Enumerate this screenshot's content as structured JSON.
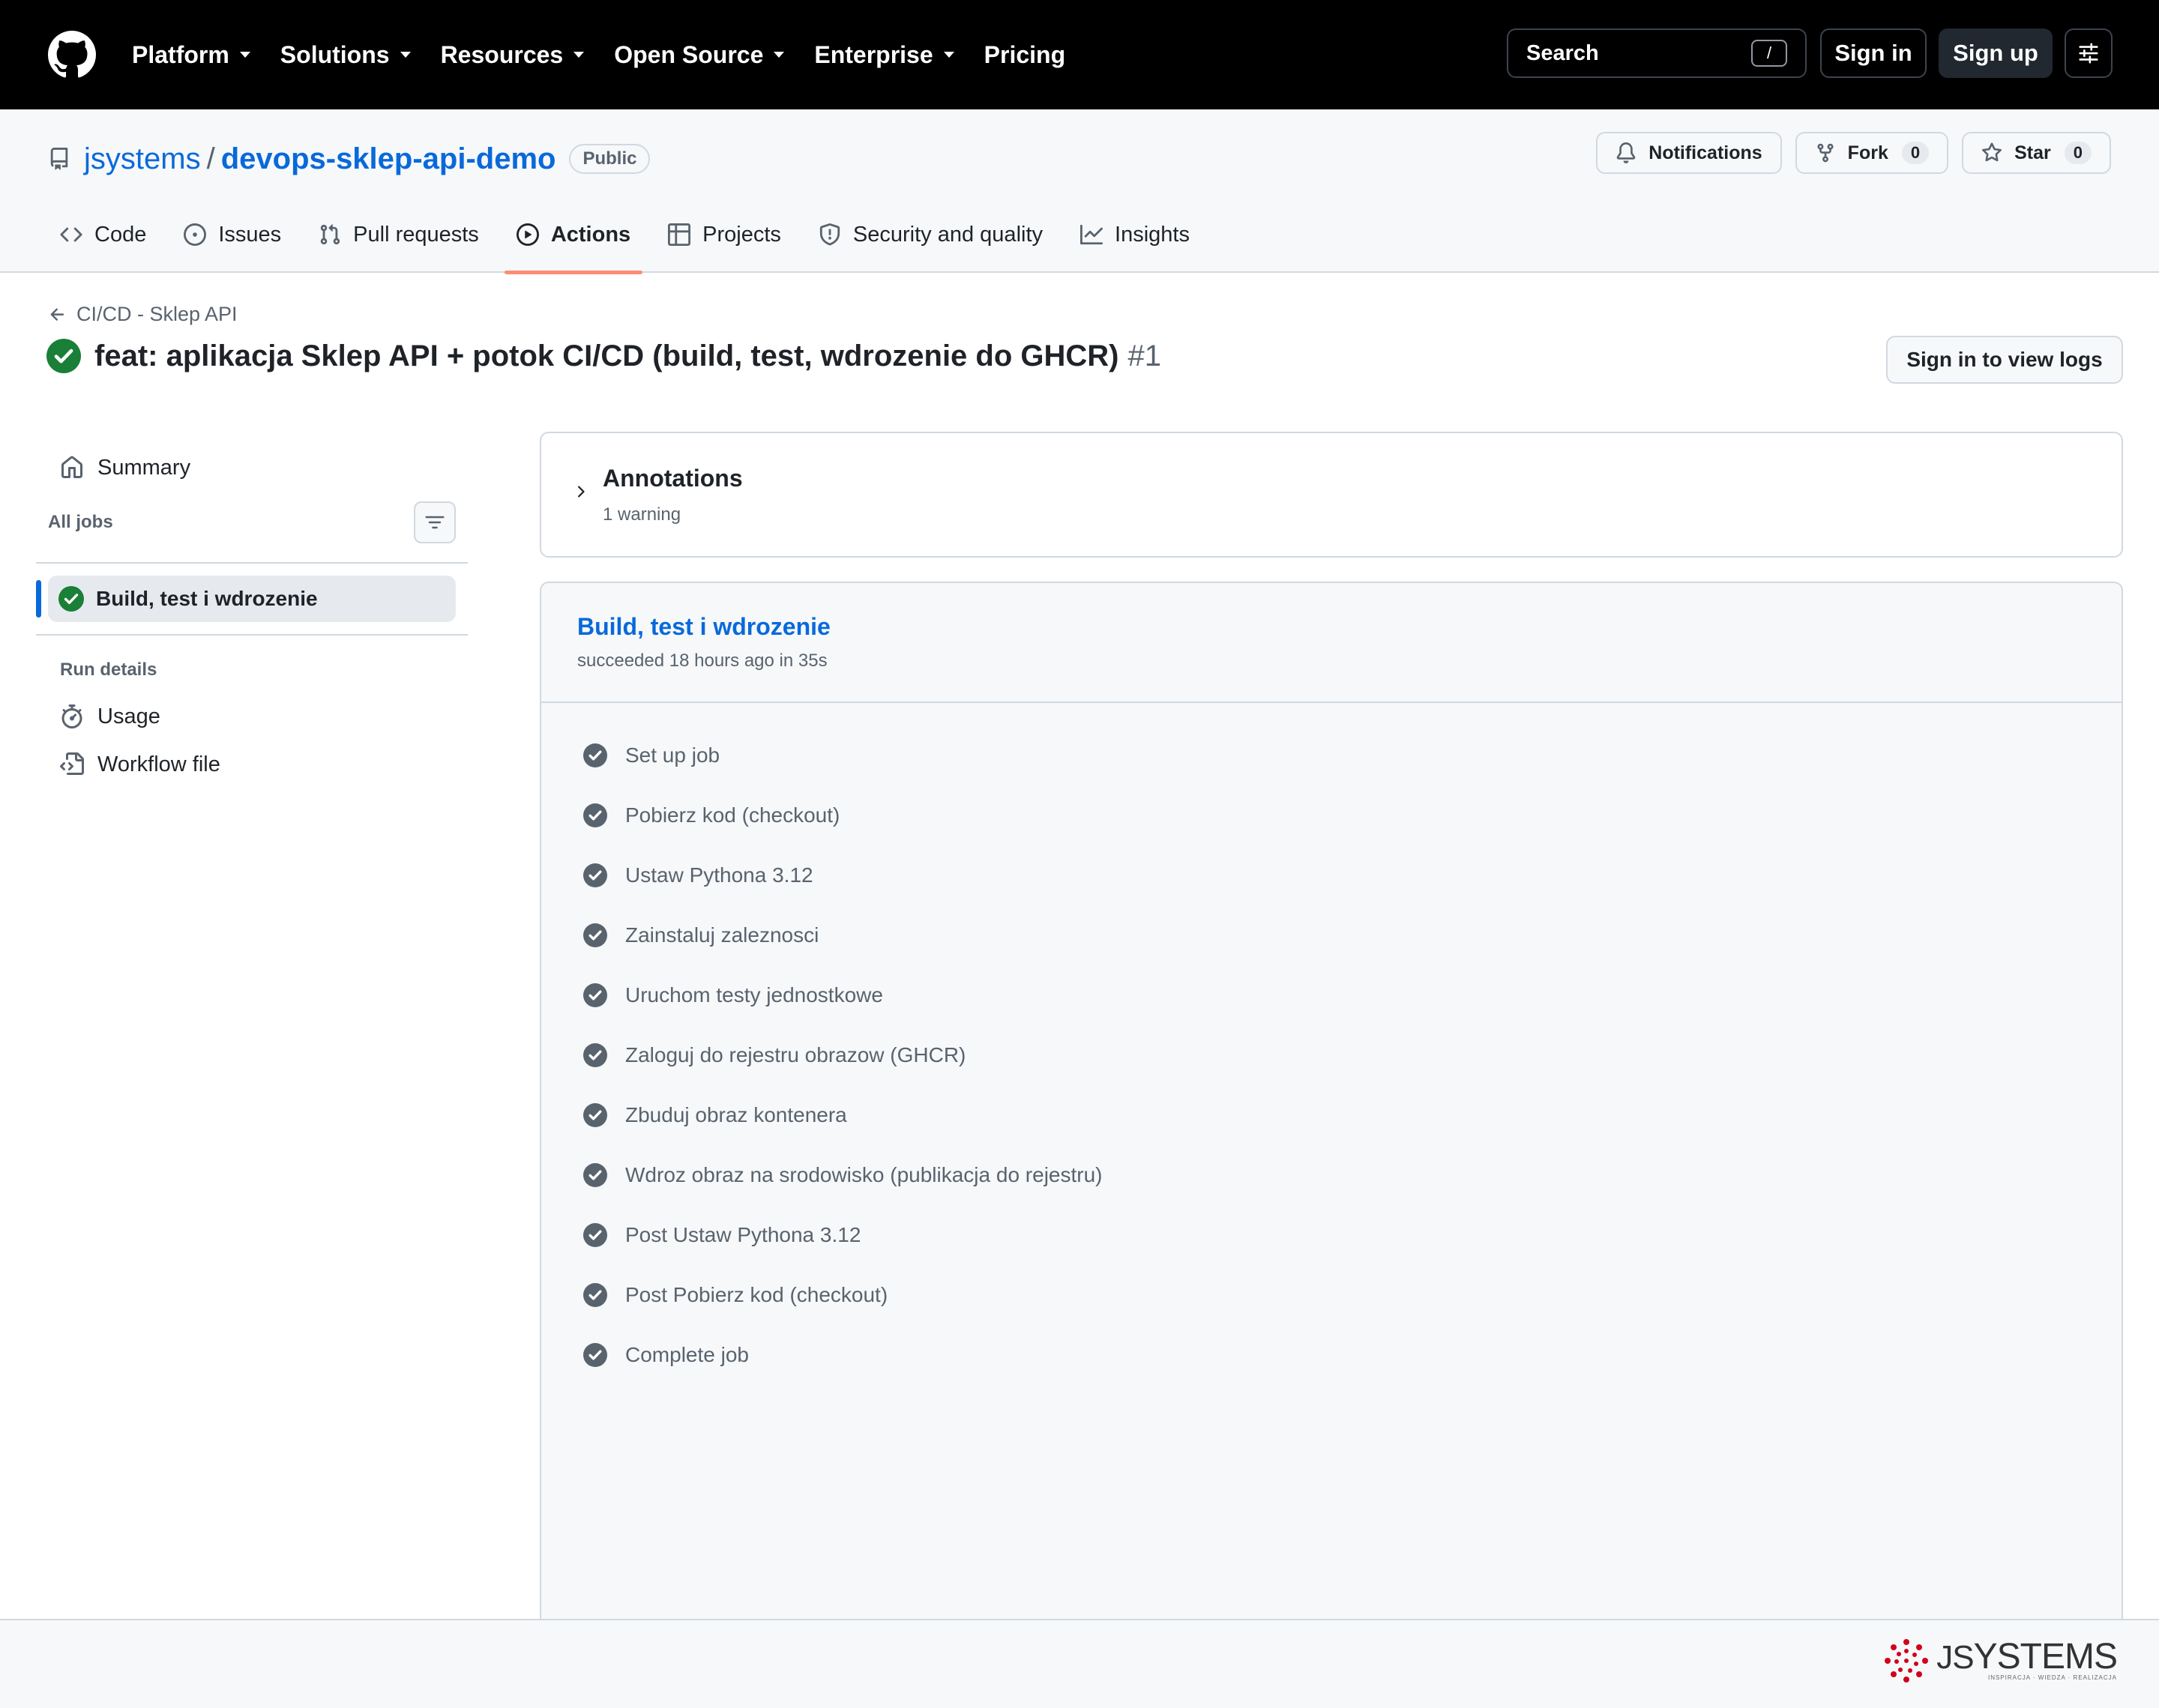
{
  "header": {
    "nav": [
      {
        "label": "Platform",
        "has_caret": true
      },
      {
        "label": "Solutions",
        "has_caret": true
      },
      {
        "label": "Resources",
        "has_caret": true
      },
      {
        "label": "Open Source",
        "has_caret": true
      },
      {
        "label": "Enterprise",
        "has_caret": true
      },
      {
        "label": "Pricing",
        "has_caret": false
      }
    ],
    "search_label": "Search",
    "search_shortcut": "/",
    "sign_in": "Sign in",
    "sign_up": "Sign up"
  },
  "repo": {
    "owner": "jsystems",
    "slash": "/",
    "name": "devops-sklep-api-demo",
    "visibility": "Public",
    "notifications": "Notifications",
    "fork_label": "Fork",
    "fork_count": "0",
    "star_label": "Star",
    "star_count": "0",
    "tabs": [
      {
        "label": "Code",
        "icon": "code-icon"
      },
      {
        "label": "Issues",
        "icon": "issue-icon"
      },
      {
        "label": "Pull requests",
        "icon": "pull-request-icon"
      },
      {
        "label": "Actions",
        "icon": "play-icon",
        "active": true
      },
      {
        "label": "Projects",
        "icon": "table-icon"
      },
      {
        "label": "Security and quality",
        "icon": "shield-icon"
      },
      {
        "label": "Insights",
        "icon": "graph-icon"
      }
    ]
  },
  "run": {
    "workflow_name": "CI/CD - Sklep API",
    "title": "feat: aplikacja Sklep API + potok CI/CD (build, test, wdrozenie do GHCR)",
    "number": "#1",
    "status": "success",
    "view_logs": "Sign in to view logs"
  },
  "sidebar": {
    "summary": "Summary",
    "all_jobs": "All jobs",
    "jobs": [
      {
        "label": "Build, test i wdrozenie",
        "status": "success"
      }
    ],
    "run_details": "Run details",
    "usage": "Usage",
    "workflow_file": "Workflow file"
  },
  "annotations": {
    "title": "Annotations",
    "subtitle": "1 warning"
  },
  "job": {
    "title": "Build, test i wdrozenie",
    "meta": "succeeded 18 hours ago in 35s",
    "steps": [
      "Set up job",
      "Pobierz kod (checkout)",
      "Ustaw Pythona 3.12",
      "Zainstaluj zaleznosci",
      "Uruchom testy jednostkowe",
      "Zaloguj do rejestru obrazow (GHCR)",
      "Zbuduj obraz kontenera",
      "Wdroz obraz na srodowisko (publikacja do rejestru)",
      "Post Ustaw Pythona 3.12",
      "Post Pobierz kod (checkout)",
      "Complete job"
    ]
  },
  "footer": {
    "brand": "JSystems",
    "brand_tagline": "INSPIRACJA · WIEDZA · REALIZACJA"
  },
  "colors": {
    "header_bg": "#000000",
    "link": "#0969da",
    "success": "#1a7f37",
    "active_tab_underline": "#fd8c73",
    "muted": "#59636e",
    "brand_red": "#d0021b"
  }
}
